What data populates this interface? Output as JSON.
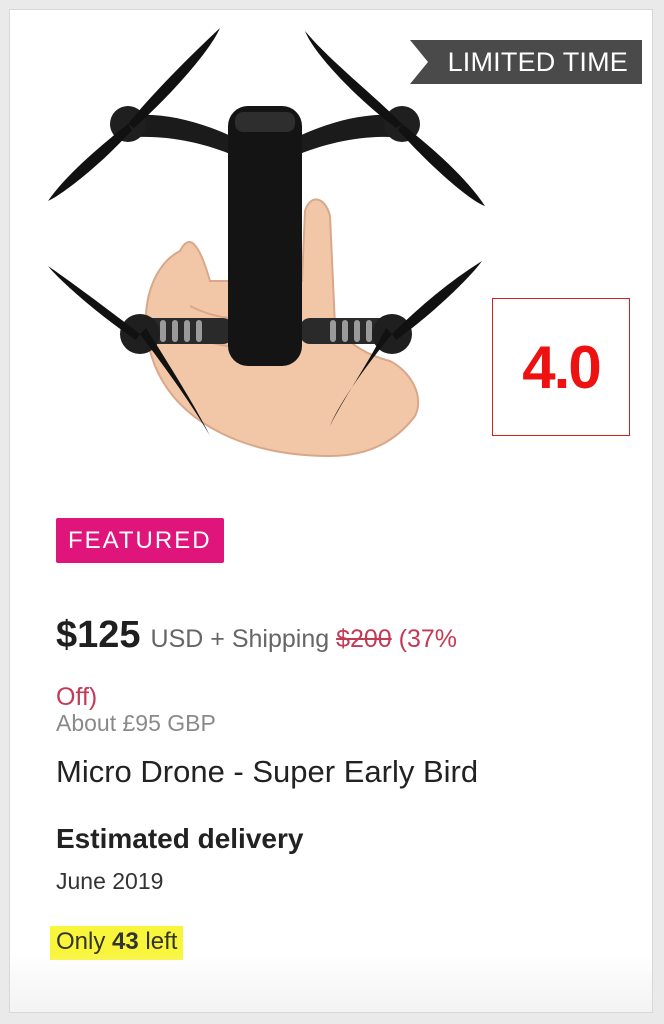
{
  "product_image": {
    "description_icon": "drone-image"
  },
  "ribbon": {
    "label": "LIMITED TIME"
  },
  "rating": {
    "value": "4.0"
  },
  "badge": {
    "label": "FEATURED",
    "color": "#e0157b"
  },
  "pricing": {
    "price": "$125",
    "currency_shipping": "USD + Shipping",
    "original_price": "$200",
    "discount_line1": " (37%",
    "discount_line2": "Off)",
    "converted": "About £95 GBP"
  },
  "product": {
    "title": "Micro Drone - Super Early Bird"
  },
  "delivery": {
    "label": "Estimated delivery",
    "date": "June 2019"
  },
  "stock": {
    "prefix": "Only",
    "count": "43",
    "suffix": "left"
  },
  "colors": {
    "accent_red": "#ee1111",
    "strike_red": "#c33a57",
    "highlight": "#f9f53a",
    "ribbon_gray": "#4a4a4a"
  }
}
